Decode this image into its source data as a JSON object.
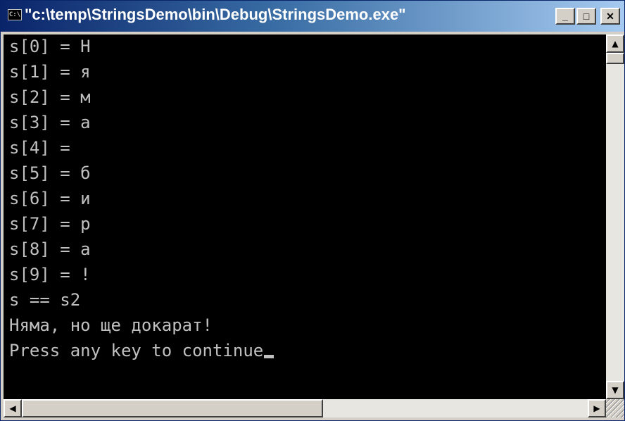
{
  "window": {
    "title": "\"c:\\temp\\StringsDemo\\bin\\Debug\\StringsDemo.exe\"",
    "icon": "console-app-icon",
    "icon_text": "C:\\",
    "buttons": {
      "minimize": "_",
      "maximize": "□",
      "close": "✕"
    }
  },
  "console": {
    "lines": [
      "s[0] = Н",
      "s[1] = я",
      "s[2] = м",
      "s[3] = а",
      "s[4] =",
      "s[5] = б",
      "s[6] = и",
      "s[7] = р",
      "s[8] = а",
      "s[9] = !",
      "s == s2",
      "Няма, но ще докарат!",
      "Press any key to continue"
    ]
  },
  "scrollbars": {
    "up_arrow": "▲",
    "down_arrow": "▼",
    "left_arrow": "◀",
    "right_arrow": "▶"
  },
  "colors": {
    "console_bg": "#000000",
    "console_fg": "#c0c0c0",
    "title_start": "#0a246a",
    "title_end": "#a6caf0"
  }
}
